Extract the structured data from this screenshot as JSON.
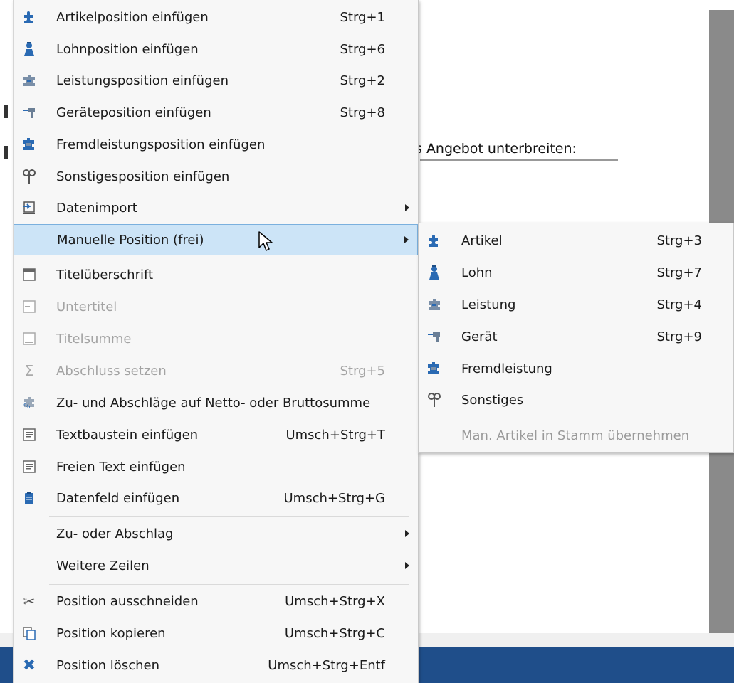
{
  "document": {
    "text": "s Angebot unterbreiten:"
  },
  "menu": {
    "items": [
      {
        "label": "Artikelposition einfügen",
        "shortcut": "Strg+1",
        "icon": "puzzle-icon"
      },
      {
        "label": "Lohnposition einfügen",
        "shortcut": "Strg+6",
        "icon": "worker-icon"
      },
      {
        "label": "Leistungsposition einfügen",
        "shortcut": "Strg+2",
        "icon": "service-icon"
      },
      {
        "label": "Geräteposition einfügen",
        "shortcut": "Strg+8",
        "icon": "drill-icon"
      },
      {
        "label": "Fremdleistungsposition einfügen",
        "shortcut": "",
        "icon": "external-service-icon"
      },
      {
        "label": "Sonstigesposition einfügen",
        "shortcut": "",
        "icon": "misc-icon"
      },
      {
        "label": "Datenimport",
        "shortcut": "",
        "icon": "import-icon",
        "submenu": true
      },
      {
        "label": "Manuelle Position (frei)",
        "shortcut": "",
        "icon": "",
        "submenu": true,
        "highlighted": true
      },
      {
        "label": "Titelüberschrift",
        "shortcut": "",
        "icon": "title-header-icon"
      },
      {
        "label": "Untertitel",
        "shortcut": "",
        "icon": "subtitle-icon",
        "disabled": true
      },
      {
        "label": "Titelsumme",
        "shortcut": "",
        "icon": "title-sum-icon",
        "disabled": true
      },
      {
        "label": "Abschluss setzen",
        "shortcut": "Strg+5",
        "icon": "sigma-icon",
        "disabled": true
      },
      {
        "label": "Zu- und Abschläge auf Netto- oder Bruttosumme",
        "shortcut": "",
        "icon": "surcharge-icon"
      },
      {
        "label": "Textbaustein einfügen",
        "shortcut": "Umsch+Strg+T",
        "icon": "text-block-icon"
      },
      {
        "label": "Freien Text einfügen",
        "shortcut": "",
        "icon": "free-text-icon"
      },
      {
        "label": "Datenfeld einfügen",
        "shortcut": "Umsch+Strg+G",
        "icon": "data-field-icon"
      },
      {
        "label": "Zu- oder Abschlag",
        "shortcut": "",
        "icon": "",
        "submenu": true
      },
      {
        "label": "Weitere Zeilen",
        "shortcut": "",
        "icon": "",
        "submenu": true
      },
      {
        "label": "Position ausschneiden",
        "shortcut": "Umsch+Strg+X",
        "icon": "scissors-icon"
      },
      {
        "label": "Position kopieren",
        "shortcut": "Umsch+Strg+C",
        "icon": "copy-icon"
      },
      {
        "label": "Position löschen",
        "shortcut": "Umsch+Strg+Entf",
        "icon": "delete-icon"
      }
    ]
  },
  "submenu": {
    "items": [
      {
        "label": "Artikel",
        "shortcut": "Strg+3",
        "icon": "puzzle-icon"
      },
      {
        "label": "Lohn",
        "shortcut": "Strg+7",
        "icon": "worker-icon"
      },
      {
        "label": "Leistung",
        "shortcut": "Strg+4",
        "icon": "service-icon"
      },
      {
        "label": "Gerät",
        "shortcut": "Strg+9",
        "icon": "drill-icon"
      },
      {
        "label": "Fremdleistung",
        "shortcut": "",
        "icon": "external-service-icon"
      },
      {
        "label": "Sonstiges",
        "shortcut": "",
        "icon": "misc-icon"
      },
      {
        "label": "Man. Artikel in Stamm übernehmen",
        "shortcut": "",
        "icon": "",
        "disabled": true
      }
    ]
  }
}
